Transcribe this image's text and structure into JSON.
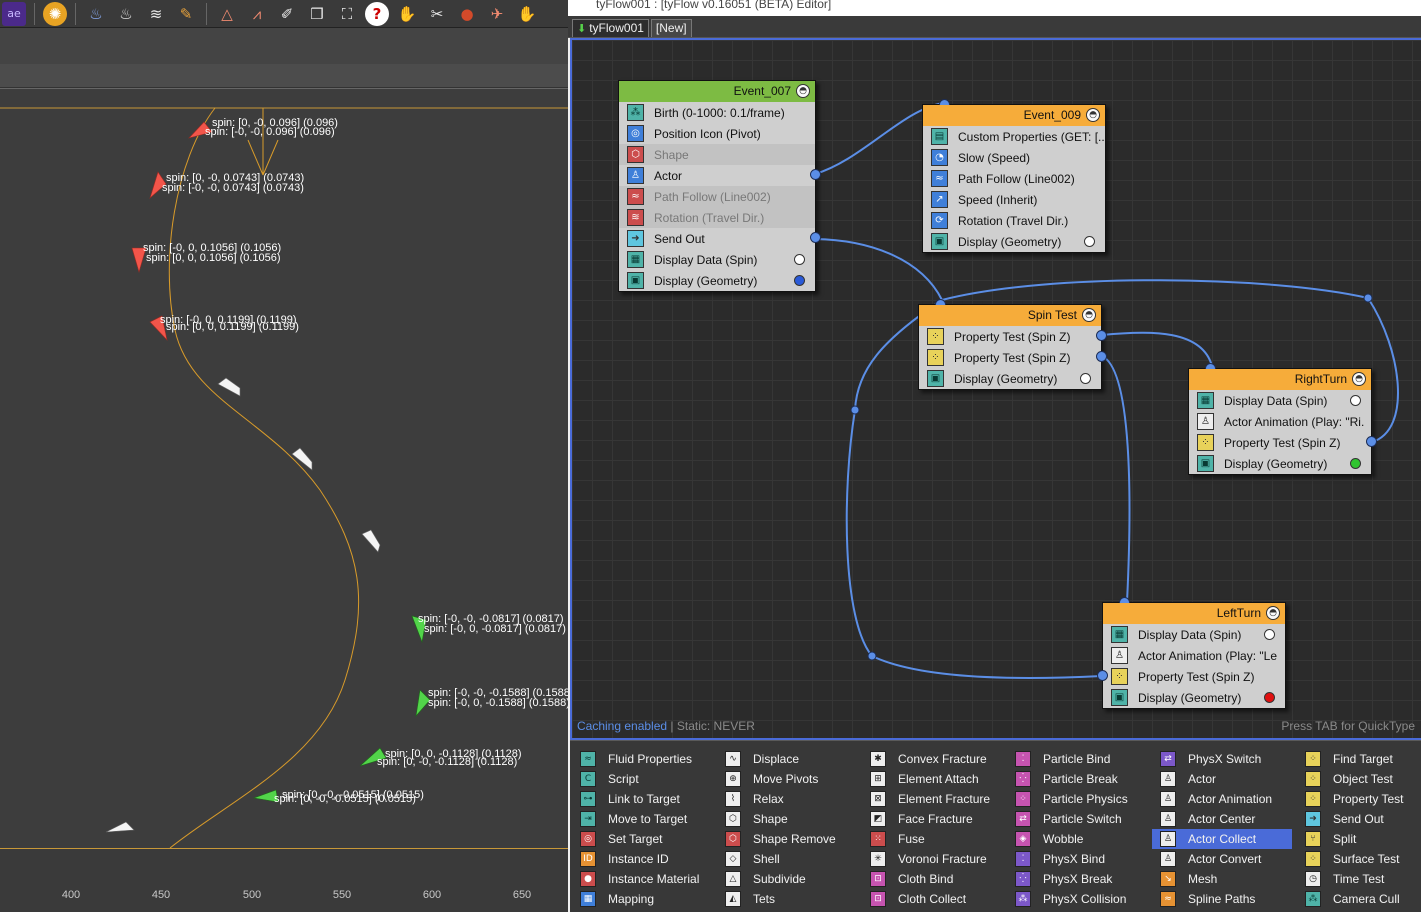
{
  "viewport": {
    "labels": [
      [
        "spin: [0, -0, 0.096] (0.096)",
        "spin: [-0, -0, 0.096] (0.096)"
      ],
      [
        "spin: [0, -0, 0.0743] (0.0743)",
        "spin: [-0, -0, 0.0743] (0.0743)"
      ],
      [
        "spin: [-0, 0, 0.1056] (0.1056)",
        "spin: [0, 0, 0.1056] (0.1056)"
      ],
      [
        "spin: [-0, 0, 0.1199] (0.1199)",
        "spin: [0, 0, 0.1199] (0.1199)"
      ],
      [
        "spin: [-0, -0, -0.0817] (0.0817)",
        "spin: [-0, 0, -0.0817] (0.0817)"
      ],
      [
        "spin: [-0, -0, -0.1588] (0.1588)",
        "spin: [-0, 0, -0.1588] (0.1588)"
      ],
      [
        "spin: [0, 0, -0.1128] (0.1128)",
        "spin: [0, -0, -0.1128] (0.1128)"
      ],
      [
        "spin: [0, -0, -0.0515] (0.0515)",
        "spin: [0, -0, -0.0515] (0.0515)"
      ]
    ],
    "ruler_labels": [
      "400",
      "450",
      "500",
      "550",
      "600",
      "650"
    ],
    "colors": {
      "red_arrow": "#f2554a",
      "green_arrow": "#52d44a",
      "white_arrow": "#f4f4f4",
      "path": "#d89b2a"
    }
  },
  "toolbar": {
    "icons": [
      "max-logo-icon",
      "material-ball-icon",
      "fire-icon",
      "flame-icon",
      "spring-icon",
      "wrench-icon",
      "bone-icon",
      "biped-icon",
      "pen-icon",
      "box-icon",
      "frame-icon",
      "help-icon",
      "hand-icon",
      "scissors-icon",
      "ball-icon",
      "rocket-icon",
      "grab-icon"
    ]
  },
  "editor": {
    "title": "tyFlow001 : [tyFlow v0.16051 (BETA) Editor]",
    "tabs": [
      {
        "label": "tyFlow001"
      },
      {
        "label": "[New]"
      }
    ],
    "status_cache": "Caching enabled",
    "status_static": "| Static: NEVER",
    "status_hint": "Press TAB for QuickType"
  },
  "nodes": {
    "event_007": {
      "title": "Event_007",
      "ops": [
        {
          "label": "Birth (0-1000: 0.1/frame)",
          "icon": "birth-icon"
        },
        {
          "label": "Position Icon (Pivot)",
          "icon": "position-icon"
        },
        {
          "label": "Shape",
          "icon": "shape-icon"
        },
        {
          "label": "Actor",
          "icon": "actor-icon"
        },
        {
          "label": "Path Follow (Line002)",
          "icon": "path-follow-icon"
        },
        {
          "label": "Rotation (Travel Dir.)",
          "icon": "rotation-icon"
        },
        {
          "label": "Send Out",
          "icon": "send-out-icon"
        },
        {
          "label": "Display Data (Spin)",
          "icon": "display-data-icon"
        },
        {
          "label": "Display (Geometry)",
          "icon": "display-icon"
        }
      ]
    },
    "event_009": {
      "title": "Event_009",
      "ops": [
        {
          "label": "Custom Properties (GET: [...",
          "icon": "custom-properties-icon"
        },
        {
          "label": "Slow (Speed)",
          "icon": "slow-icon"
        },
        {
          "label": "Path Follow (Line002)",
          "icon": "path-follow-icon"
        },
        {
          "label": "Speed (Inherit)",
          "icon": "speed-icon"
        },
        {
          "label": "Rotation (Travel Dir.)",
          "icon": "rotation-icon"
        },
        {
          "label": "Display (Geometry)",
          "icon": "display-icon"
        }
      ]
    },
    "spin_test": {
      "title": "Spin Test",
      "ops": [
        {
          "label": "Property Test (Spin Z)",
          "icon": "property-test-icon"
        },
        {
          "label": "Property Test (Spin Z)",
          "icon": "property-test-icon"
        },
        {
          "label": "Display (Geometry)",
          "icon": "display-icon"
        }
      ]
    },
    "right_turn": {
      "title": "RightTurn",
      "ops": [
        {
          "label": "Display Data (Spin)",
          "icon": "display-data-icon"
        },
        {
          "label": "Actor Animation (Play: \"Ri...",
          "icon": "actor-animation-icon"
        },
        {
          "label": "Property Test (Spin Z)",
          "icon": "property-test-icon"
        },
        {
          "label": "Display (Geometry)",
          "icon": "display-icon"
        }
      ]
    },
    "left_turn": {
      "title": "LeftTurn",
      "ops": [
        {
          "label": "Display Data (Spin)",
          "icon": "display-data-icon"
        },
        {
          "label": "Actor Animation (Play: \"Le...",
          "icon": "actor-animation-icon"
        },
        {
          "label": "Property Test (Spin Z)",
          "icon": "property-test-icon"
        },
        {
          "label": "Display (Geometry)",
          "icon": "display-icon"
        }
      ]
    }
  },
  "palette": {
    "columns": [
      [
        {
          "label": "Fluid Properties",
          "icon": "fluid-properties-icon"
        },
        {
          "label": "Script",
          "icon": "script-icon"
        },
        {
          "label": "Link to Target",
          "icon": "link-to-target-icon"
        },
        {
          "label": "Move to Target",
          "icon": "move-to-target-icon"
        },
        {
          "label": "Set Target",
          "icon": "set-target-icon"
        },
        {
          "label": "Instance ID",
          "icon": "instance-id-icon"
        },
        {
          "label": "Instance Material",
          "icon": "instance-material-icon"
        },
        {
          "label": "Mapping",
          "icon": "mapping-icon"
        }
      ],
      [
        {
          "label": "Displace",
          "icon": "displace-icon"
        },
        {
          "label": "Move Pivots",
          "icon": "move-pivots-icon"
        },
        {
          "label": "Relax",
          "icon": "relax-icon"
        },
        {
          "label": "Shape",
          "icon": "shape-icon"
        },
        {
          "label": "Shape Remove",
          "icon": "shape-remove-icon"
        },
        {
          "label": "Shell",
          "icon": "shell-icon"
        },
        {
          "label": "Subdivide",
          "icon": "subdivide-icon"
        },
        {
          "label": "Tets",
          "icon": "tets-icon"
        }
      ],
      [
        {
          "label": "Convex Fracture",
          "icon": "convex-fracture-icon"
        },
        {
          "label": "Element Attach",
          "icon": "element-attach-icon"
        },
        {
          "label": "Element Fracture",
          "icon": "element-fracture-icon"
        },
        {
          "label": "Face Fracture",
          "icon": "face-fracture-icon"
        },
        {
          "label": "Fuse",
          "icon": "fuse-icon"
        },
        {
          "label": "Voronoi Fracture",
          "icon": "voronoi-fracture-icon"
        },
        {
          "label": "Cloth Bind",
          "icon": "cloth-bind-icon"
        },
        {
          "label": "Cloth Collect",
          "icon": "cloth-collect-icon"
        }
      ],
      [
        {
          "label": "Particle Bind",
          "icon": "particle-bind-icon"
        },
        {
          "label": "Particle Break",
          "icon": "particle-break-icon"
        },
        {
          "label": "Particle Physics",
          "icon": "particle-physics-icon"
        },
        {
          "label": "Particle Switch",
          "icon": "particle-switch-icon"
        },
        {
          "label": "Wobble",
          "icon": "wobble-icon"
        },
        {
          "label": "PhysX Bind",
          "icon": "physx-bind-icon"
        },
        {
          "label": "PhysX Break",
          "icon": "physx-break-icon"
        },
        {
          "label": "PhysX Collision",
          "icon": "physx-collision-icon"
        }
      ],
      [
        {
          "label": "PhysX Switch",
          "icon": "physx-switch-icon"
        },
        {
          "label": "Actor",
          "icon": "actor-icon"
        },
        {
          "label": "Actor Animation",
          "icon": "actor-animation-icon"
        },
        {
          "label": "Actor Center",
          "icon": "actor-center-icon"
        },
        {
          "label": "Actor Collect",
          "icon": "actor-collect-icon",
          "selected": true
        },
        {
          "label": "Actor Convert",
          "icon": "actor-convert-icon"
        },
        {
          "label": "Mesh",
          "icon": "mesh-icon"
        },
        {
          "label": "Spline Paths",
          "icon": "spline-paths-icon"
        }
      ],
      [
        {
          "label": "Find Target",
          "icon": "find-target-icon"
        },
        {
          "label": "Object Test",
          "icon": "object-test-icon"
        },
        {
          "label": "Property Test",
          "icon": "property-test-icon"
        },
        {
          "label": "Send Out",
          "icon": "send-out-icon"
        },
        {
          "label": "Split",
          "icon": "split-icon"
        },
        {
          "label": "Surface Test",
          "icon": "surface-test-icon"
        },
        {
          "label": "Time Test",
          "icon": "time-test-icon"
        },
        {
          "label": "Camera Cull",
          "icon": "camera-cull-icon"
        }
      ]
    ]
  }
}
